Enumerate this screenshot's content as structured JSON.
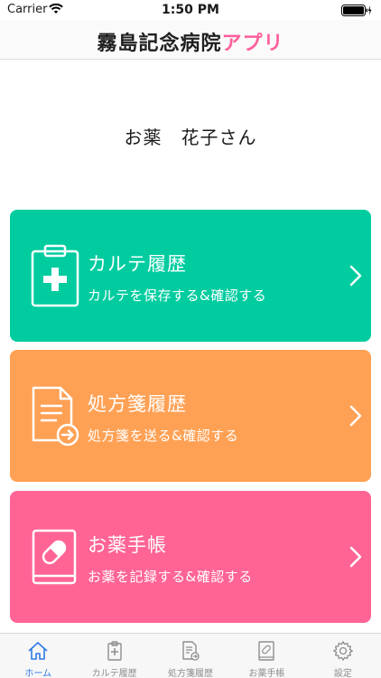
{
  "status_bar": {
    "carrier": "Carrier",
    "time": "1:50 PM"
  },
  "header": {
    "title_main": "霧島記念病院",
    "title_accent": "アプリ",
    "accent_color": "#ff5e9c"
  },
  "greeting": "お薬　花子さん",
  "cards": [
    {
      "title": "カルテ履歴",
      "subtitle": "カルテを保存する&確認する",
      "icon": "clipboard-plus-icon",
      "color": "#00cca0"
    },
    {
      "title": "処方箋履歴",
      "subtitle": "処方箋を送る&確認する",
      "icon": "document-arrow-icon",
      "color": "#ffa155"
    },
    {
      "title": "お薬手帳",
      "subtitle": "お薬を記録する&確認する",
      "icon": "medicine-book-icon",
      "color": "#ff6495"
    }
  ],
  "tabs": [
    {
      "label": "ホーム",
      "icon": "home-icon",
      "active": true
    },
    {
      "label": "カルテ履歴",
      "icon": "clipboard-plus-icon",
      "active": false
    },
    {
      "label": "処方箋履歴",
      "icon": "document-arrow-icon",
      "active": false
    },
    {
      "label": "お薬手帳",
      "icon": "medicine-book-icon",
      "active": false
    },
    {
      "label": "設定",
      "icon": "gear-icon",
      "active": false
    }
  ],
  "colors": {
    "active_tab": "#2f7ae5",
    "inactive_tab": "#8e8e8e"
  }
}
